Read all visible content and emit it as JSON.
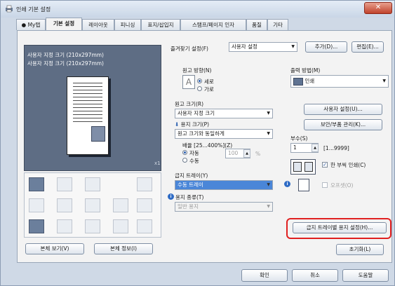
{
  "window": {
    "title": "인쇄 기본 설정",
    "close_glyph": "✕"
  },
  "tabs": [
    "My탭",
    "기본 설정",
    "레이아웃",
    "피니싱",
    "표지/삽입지",
    "스탬프/페이지 인자",
    "품질",
    "기타"
  ],
  "preview": {
    "line1": "사용자 지정 크기 (210x297mm)",
    "line2": "사용자 지정 크기 (210x297mm)",
    "page_count": "x1"
  },
  "left_buttons": {
    "view": "본체 보기(V)",
    "info": "본체 정보(I)"
  },
  "favorites": {
    "label": "즐겨찾기 설정(F)",
    "value": "사용자 설정",
    "add": "추가(D)...",
    "edit": "편집(E)..."
  },
  "orientation": {
    "label": "원고 방향(N)",
    "portrait": "세로",
    "landscape": "가로"
  },
  "original_size": {
    "label": "원고 크기(R)",
    "value": "사용자 지정 크기"
  },
  "paper_size": {
    "label": "용지 크기(P)",
    "value": "원고 크기와 동일하게"
  },
  "zoom": {
    "label": "배율 [25...400%](Z)",
    "auto": "자동",
    "manual": "수동",
    "value": "100",
    "unit": "%"
  },
  "paper_tray": {
    "label": "급지 트레이(Y)",
    "value": "수동 트레이"
  },
  "paper_type": {
    "label": "용지 종류(T)",
    "value": "일반 용지"
  },
  "output_method": {
    "label": "출력 방법(M)",
    "value": "인쇄"
  },
  "right_buttons": {
    "user_settings": "사용자 설정(U)...",
    "box_management": "보안/부품 관리(K)...",
    "tray_paper_settings": "급지 트레이별 용지 설정(H)...",
    "defaults": "초기화(L)"
  },
  "copies": {
    "label": "부수(S)",
    "value": "1",
    "range": "[1...9999]"
  },
  "collate": {
    "label": "한 부씩 인쇄(C)"
  },
  "offset": {
    "label": "오프셋(O)"
  },
  "footer": {
    "ok": "확인",
    "cancel": "취소",
    "help": "도움말"
  },
  "colors": {
    "highlight_box": "#e02020",
    "accent": "#4a86d8",
    "preview_bg": "#5e6d84"
  }
}
